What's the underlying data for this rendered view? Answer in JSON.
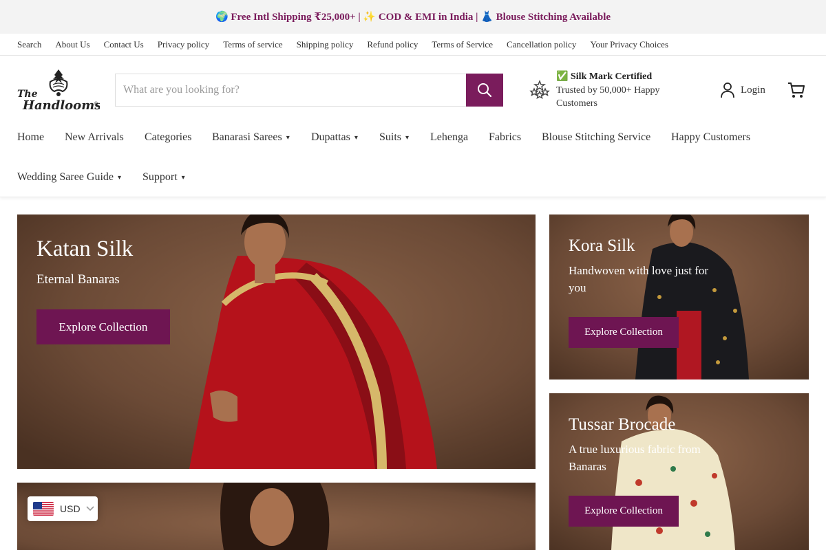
{
  "announcement": "🌍 Free Intl Shipping ₹25,000+ | ✨ COD & EMI in India | 👗 Blouse Stitching Available",
  "utility_links": [
    "Search",
    "About Us",
    "Contact Us",
    "Privacy policy",
    "Terms of service",
    "Shipping policy",
    "Refund policy",
    "Terms of Service",
    "Cancellation policy",
    "Your Privacy Choices"
  ],
  "logo": {
    "line1": "The",
    "line2": "Handlooms",
    "mark": "®"
  },
  "search": {
    "placeholder": "What are you looking for?",
    "value": ""
  },
  "trust": {
    "title": "✅ Silk Mark Certified",
    "subtitle": "Trusted by 50,000+ Happy Customers"
  },
  "header": {
    "login_label": "Login"
  },
  "nav": {
    "row1": [
      {
        "label": "Home",
        "dropdown": false
      },
      {
        "label": "New Arrivals",
        "dropdown": false
      },
      {
        "label": "Categories",
        "dropdown": false
      },
      {
        "label": "Banarasi Sarees",
        "dropdown": true
      },
      {
        "label": "Dupattas",
        "dropdown": true
      },
      {
        "label": "Suits",
        "dropdown": true
      },
      {
        "label": "Lehenga",
        "dropdown": false
      },
      {
        "label": "Fabrics",
        "dropdown": false
      },
      {
        "label": "Blouse Stitching Service",
        "dropdown": false
      },
      {
        "label": "Happy Customers",
        "dropdown": false
      }
    ],
    "row2": [
      {
        "label": "Wedding Saree Guide",
        "dropdown": true
      },
      {
        "label": "Support",
        "dropdown": true
      }
    ]
  },
  "banners": [
    {
      "title": "Katan Silk",
      "subtitle": "Eternal Banaras",
      "button": "Explore Collection",
      "saree_color": "#b5121b"
    },
    {
      "title": "Kora Silk",
      "subtitle": "Handwoven with love just for you",
      "button": "Explore Collection",
      "saree_color": "#1a1a1e"
    },
    {
      "title": "Tussar Brocade",
      "subtitle": "A true luxurious fabric from Banaras",
      "button": "Explore Collection",
      "saree_color": "#efe6c8"
    },
    {
      "title": "",
      "subtitle": "",
      "button": "",
      "saree_color": ""
    }
  ],
  "currency": {
    "code": "USD"
  },
  "colors": {
    "brand": "#7a1c5c",
    "button": "#6e1552",
    "backdrop": "#6b4a36"
  }
}
